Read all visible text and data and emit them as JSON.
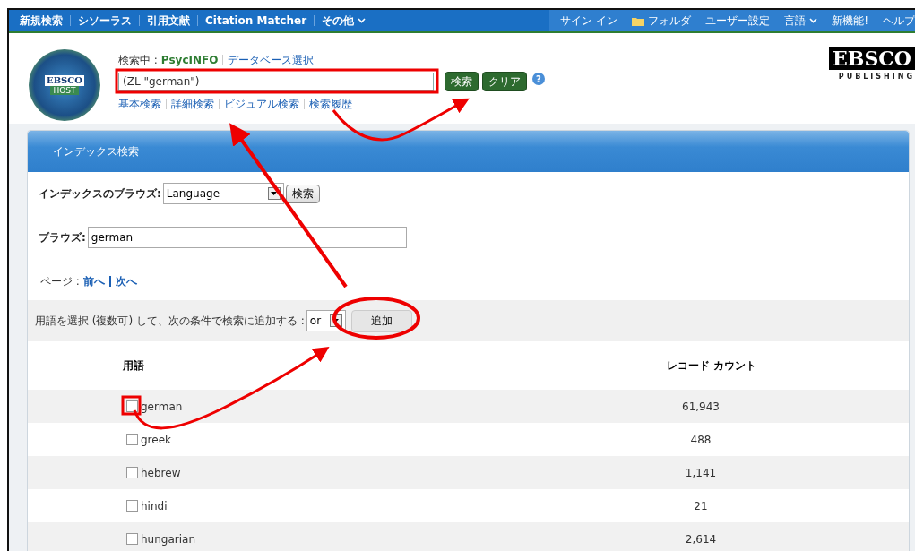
{
  "top_nav": {
    "left": [
      {
        "label": "新規検索",
        "kind": "plain"
      },
      {
        "label": "シソーラス",
        "kind": "plain"
      },
      {
        "label": "引用文献",
        "kind": "plain"
      },
      {
        "label": "Citation Matcher",
        "kind": "plain"
      },
      {
        "label": "その他",
        "kind": "menu"
      }
    ],
    "right": [
      {
        "label": "サイン イン",
        "kind": "plain"
      },
      {
        "label": "フォルダ",
        "kind": "folder"
      },
      {
        "label": "ユーザー設定",
        "kind": "plain"
      },
      {
        "label": "言語",
        "kind": "menu"
      },
      {
        "label": "新機能!",
        "kind": "plain"
      },
      {
        "label": "ヘルプ",
        "kind": "plain"
      }
    ]
  },
  "header": {
    "logo_text": "EBSCO",
    "logo_sub": "HOST",
    "searching_label": "検索中 :",
    "database": "PsycINFO",
    "choose_db": "データベース選択",
    "search_value": "(ZL \"german\")",
    "search_button": "検索",
    "clear_button": "クリア",
    "help": "?",
    "links": [
      "基本検索",
      "詳細検索",
      "ビジュアル検索",
      "検索履歴"
    ],
    "publisher_name": "EBSCO",
    "publisher_sub": "PUBLISHING"
  },
  "panel": {
    "title": "インデックス検索",
    "browse_index_label": "インデックスのブラウズ:",
    "index_value": "Language",
    "index_search_button": "検索",
    "browse_label": "ブラウズ:",
    "browse_value": "german",
    "page_label": "ページ :",
    "prev": "前へ",
    "next": "次へ",
    "add_instruction": "用語を選択 (複数可) して、次の条件で検索に追加する :",
    "operator": "or",
    "add_button": "追加",
    "table": {
      "columns": [
        "用語",
        "レコード カウント"
      ],
      "rows": [
        {
          "term": "german",
          "count": "61,943",
          "checked": false
        },
        {
          "term": "greek",
          "count": "488",
          "checked": false
        },
        {
          "term": "hebrew",
          "count": "1,141",
          "checked": false
        },
        {
          "term": "hindi",
          "count": "21",
          "checked": false
        },
        {
          "term": "hungarian",
          "count": "2,614",
          "checked": false
        }
      ]
    }
  }
}
